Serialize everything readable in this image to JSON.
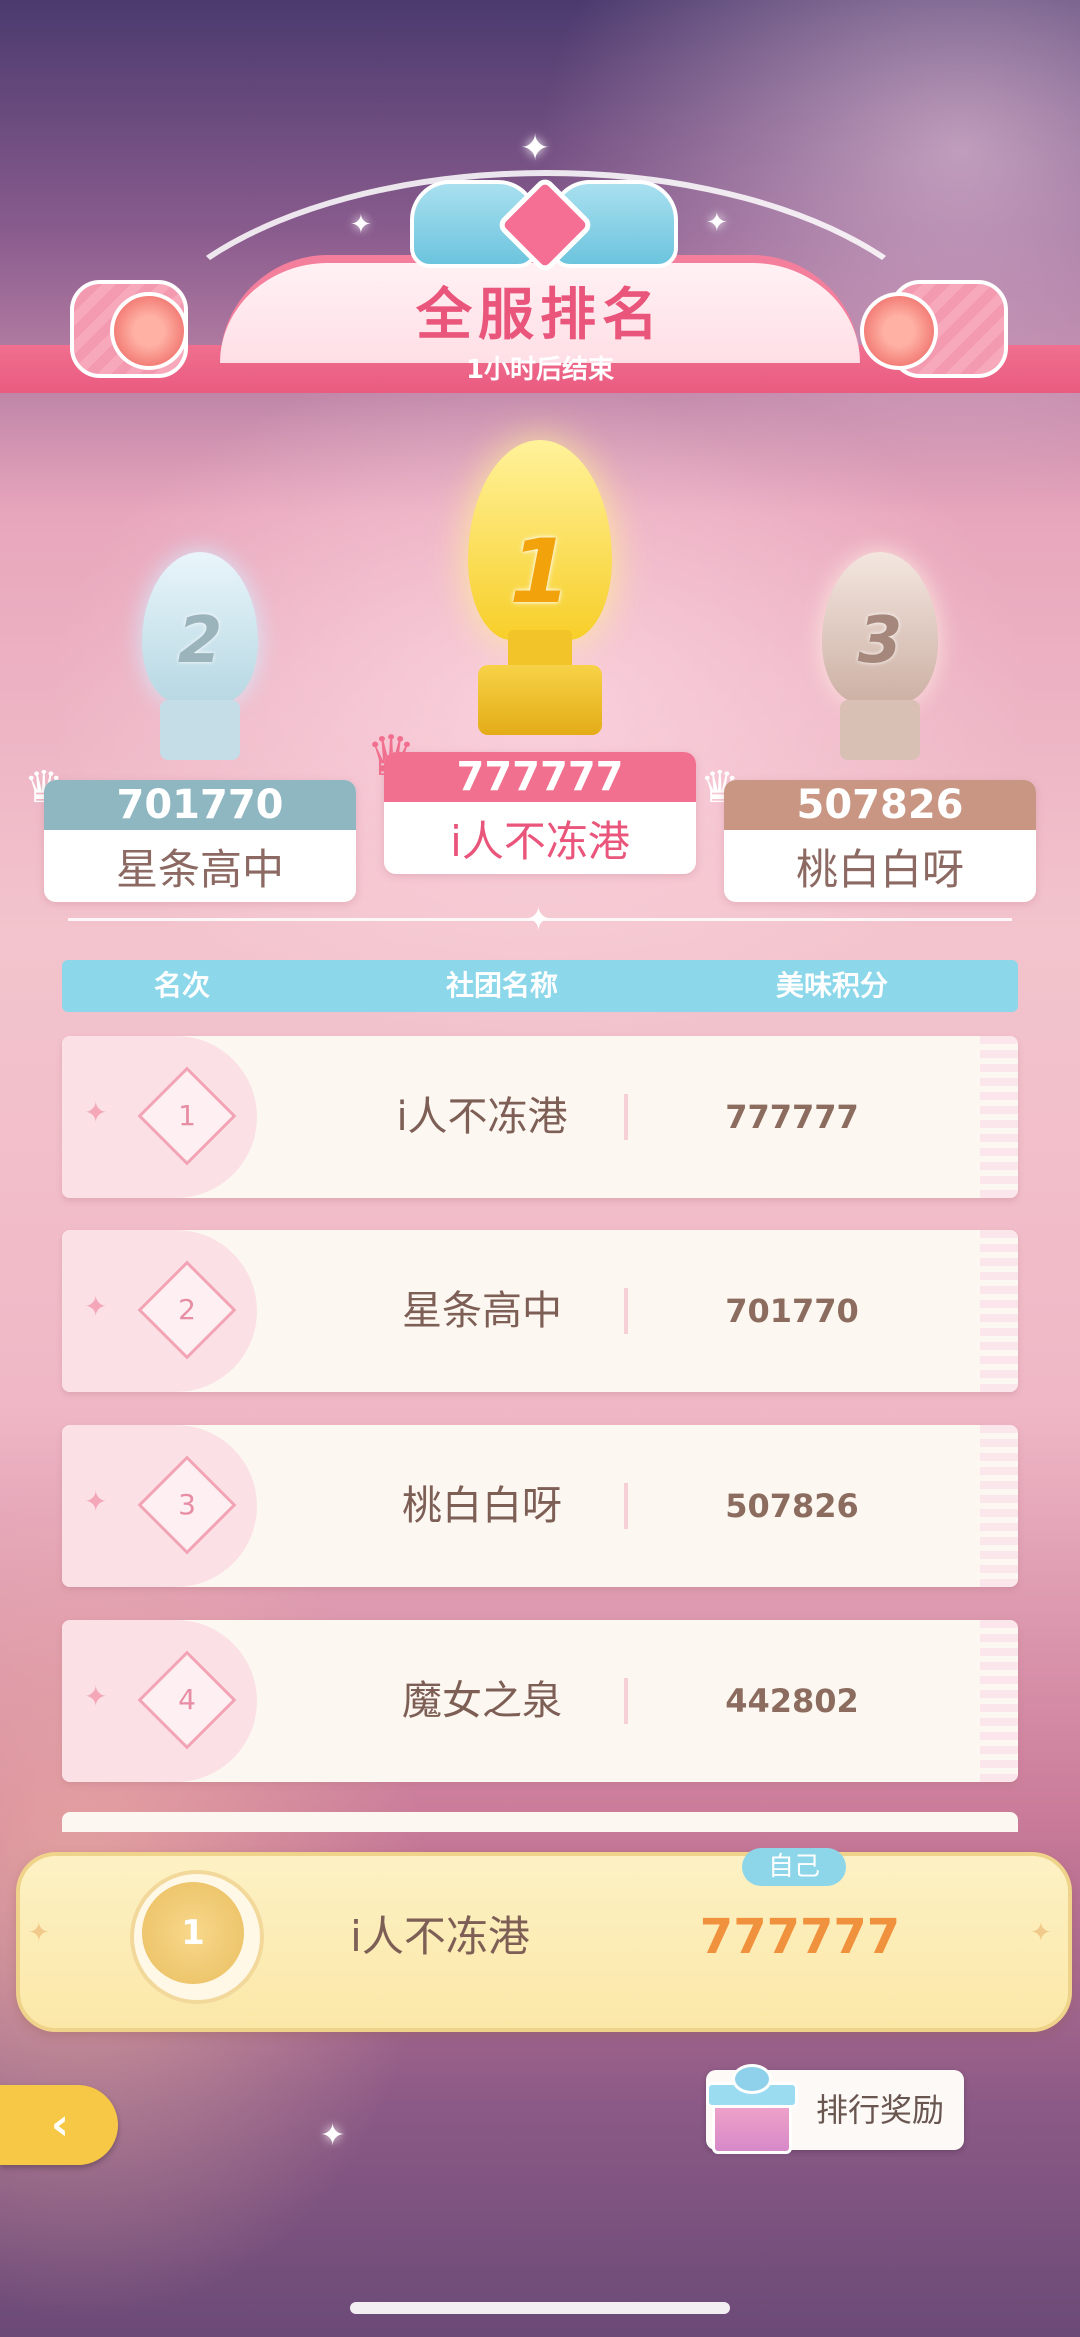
{
  "header": {
    "title": "全服排名",
    "subtitle": "1小时后结束"
  },
  "podium": [
    {
      "rank_label": "1",
      "score": "777777",
      "name": "i人不冻港",
      "color": "#f2708f"
    },
    {
      "rank_label": "2",
      "score": "701770",
      "name": "星条高中",
      "color": "#8fb7c2"
    },
    {
      "rank_label": "3",
      "score": "507826",
      "name": "桃白白呀",
      "color": "#c89683"
    }
  ],
  "table": {
    "headers": [
      "名次",
      "社团名称",
      "美味积分"
    ],
    "rows": [
      {
        "rank": "1",
        "name": "i人不冻港",
        "score": "777777"
      },
      {
        "rank": "2",
        "name": "星条高中",
        "score": "701770"
      },
      {
        "rank": "3",
        "name": "桃白白呀",
        "score": "507826"
      },
      {
        "rank": "4",
        "name": "魔女之泉",
        "score": "442802"
      }
    ]
  },
  "self": {
    "tag": "自己",
    "rank": "1",
    "name": "i人不冻港",
    "score": "777777"
  },
  "controls": {
    "back_icon": "back-arrow-icon",
    "reward_label": "排行奖励"
  },
  "colors": {
    "accent_pink": "#e9557b",
    "header_blue": "#8dd7ea",
    "score_orange": "#f0913d"
  }
}
